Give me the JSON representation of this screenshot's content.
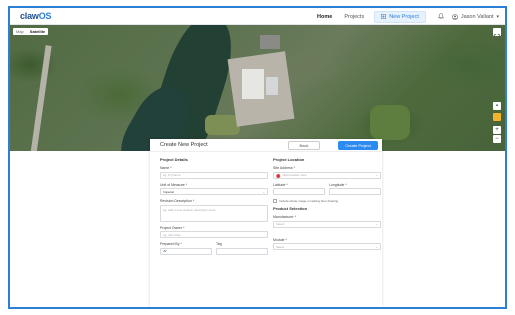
{
  "header": {
    "logo_text": "claw",
    "logo_suffix": "OS",
    "nav": [
      "Home",
      "Projects"
    ],
    "new_project_label": "New Project",
    "user_name": "Jason Vallant"
  },
  "map": {
    "map_type_options": [
      "Map",
      "Satellite"
    ],
    "selected_map_type": "Satellite"
  },
  "panel": {
    "title": "Create New Project",
    "back_label": "Back",
    "create_label": "Create Project",
    "details": {
      "section": "Project Details",
      "name_label": "Name *",
      "name_placeholder": "eg. Prj Name",
      "unit_label": "Unit of Measure *",
      "unit_value": "Imperial",
      "desc_label": "Revision Description *",
      "desc_placeholder": "eg. Add a new revision description here",
      "owner_label": "Project Owner *",
      "owner_placeholder": "eg. John Doe",
      "prepared_label": "Prepared By *",
      "prepared_value": "JV",
      "tag_label": "Tag",
      "tag_value": ""
    },
    "location": {
      "section": "Project Location",
      "address_label": "Site Address *",
      "address_placeholder": "Start location here",
      "lat_label": "Latitude *",
      "lng_label": "Longitude *",
      "checkbox_label": "Include whole image in racking floor drawing",
      "product_section": "Product Selection",
      "manufacturer_label": "Manufacturer *",
      "manufacturer_value": "Select",
      "module_label": "Module *",
      "module_value": "Select"
    }
  },
  "colors": {
    "accent": "#2b7fd4",
    "button": "#2b8bf0",
    "frame_border": "#2b7fd4"
  },
  "icons": [
    "plus-square-icon",
    "bell-icon",
    "user-circle-icon",
    "chevron-down-icon",
    "location-pin-icon",
    "fullscreen-icon",
    "zoom-in-icon",
    "zoom-out-icon",
    "pegman-icon",
    "camera-icon"
  ]
}
